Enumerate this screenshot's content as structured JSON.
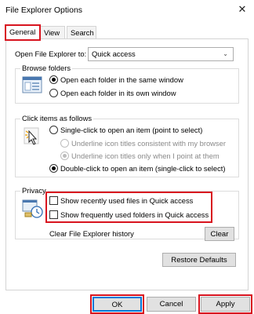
{
  "window": {
    "title": "File Explorer Options"
  },
  "tabs": [
    {
      "label": "General",
      "active": true
    },
    {
      "label": "View",
      "active": false
    },
    {
      "label": "Search",
      "active": false
    }
  ],
  "open_in": {
    "label": "Open File Explorer to:",
    "value": "Quick access"
  },
  "browse_folders": {
    "title": "Browse folders",
    "options": [
      {
        "label": "Open each folder in the same window",
        "checked": true
      },
      {
        "label": "Open each folder in its own window",
        "checked": false
      }
    ]
  },
  "click_items": {
    "title": "Click items as follows",
    "single_click": "Single-click to open an item (point to select)",
    "underline_browser": "Underline icon titles consistent with my browser",
    "underline_point": "Underline icon titles only when I point at them",
    "double_click": "Double-click to open an item (single-click to select)"
  },
  "privacy": {
    "title": "Privacy",
    "recent_files": "Show recently used files in Quick access",
    "frequent_folders": "Show frequently used folders in Quick access",
    "clear_label": "Clear File Explorer history",
    "clear_button": "Clear"
  },
  "restore_defaults": "Restore Defaults",
  "buttons": {
    "ok": "OK",
    "cancel": "Cancel",
    "apply": "Apply"
  },
  "colors": {
    "highlight": "#d8141f",
    "accent": "#0078d7"
  }
}
